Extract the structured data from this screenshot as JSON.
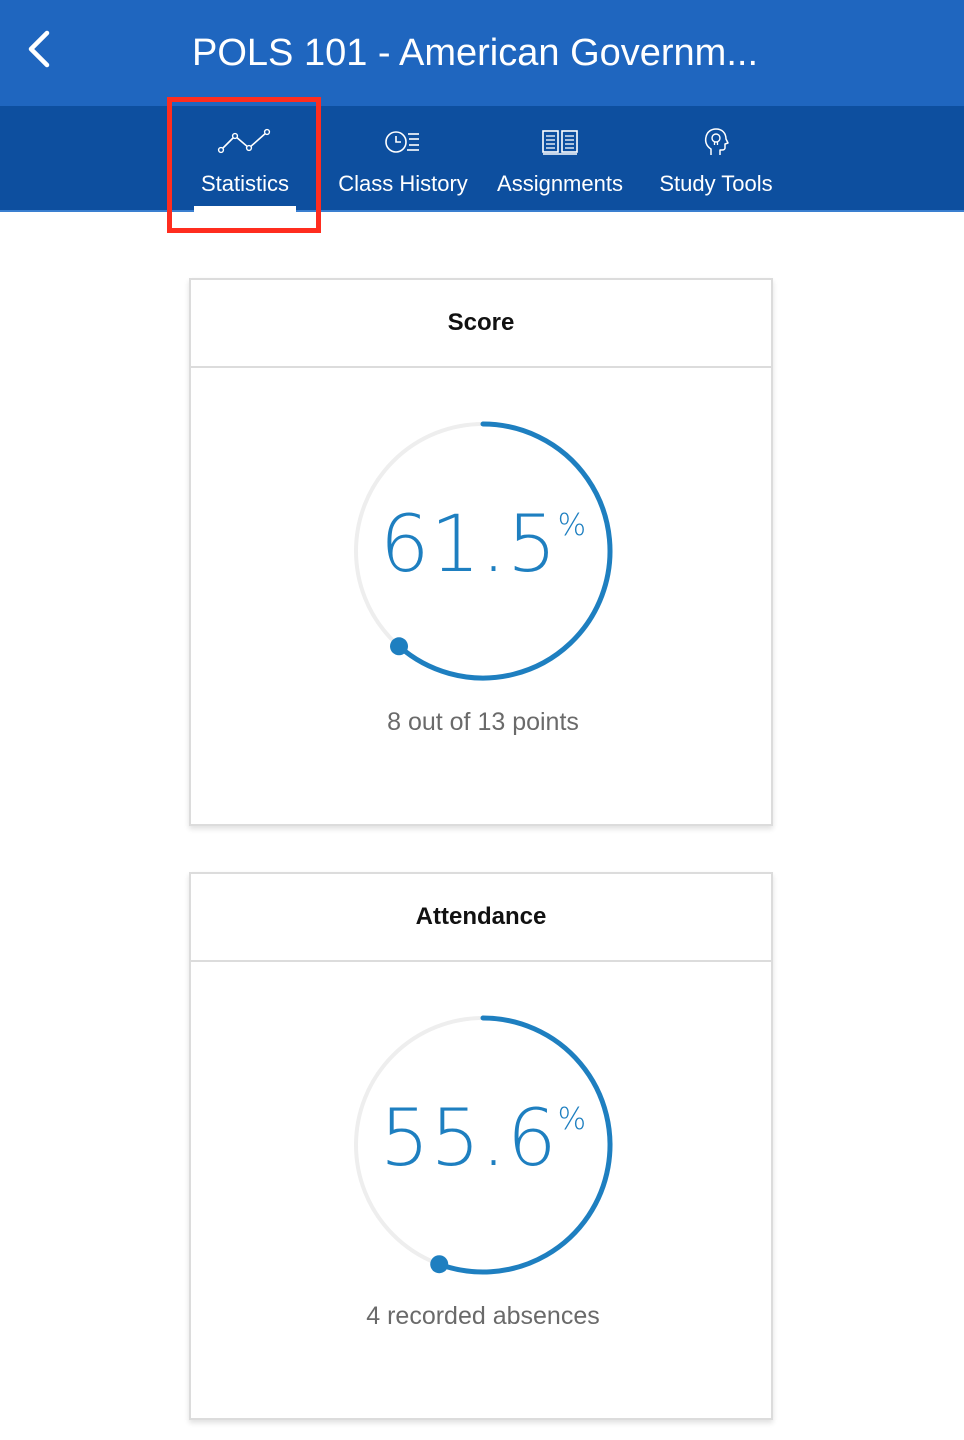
{
  "header": {
    "title": "POLS 101 - American Governm...",
    "back_icon": "chevron-left-icon"
  },
  "tabs": [
    {
      "label": "Statistics",
      "icon": "line-chart-icon",
      "selected": true
    },
    {
      "label": "Class History",
      "icon": "clock-list-icon",
      "selected": false
    },
    {
      "label": "Assignments",
      "icon": "open-book-icon",
      "selected": false
    },
    {
      "label": "Study Tools",
      "icon": "lightbulb-head-icon",
      "selected": false
    }
  ],
  "score": {
    "title": "Score",
    "value": "61.5",
    "unit": "%",
    "fraction": 0.615,
    "caption": "8 out of 13 points"
  },
  "attendance": {
    "title": "Attendance",
    "value": "55.6",
    "unit": "%",
    "fraction": 0.556,
    "caption": "4 recorded absences"
  },
  "colors": {
    "header": "#1f66bf",
    "tabbar": "#0d4f9f",
    "accent": "#1e7fc0",
    "track": "#eeeeee",
    "highlight": "#ff2d1f"
  }
}
